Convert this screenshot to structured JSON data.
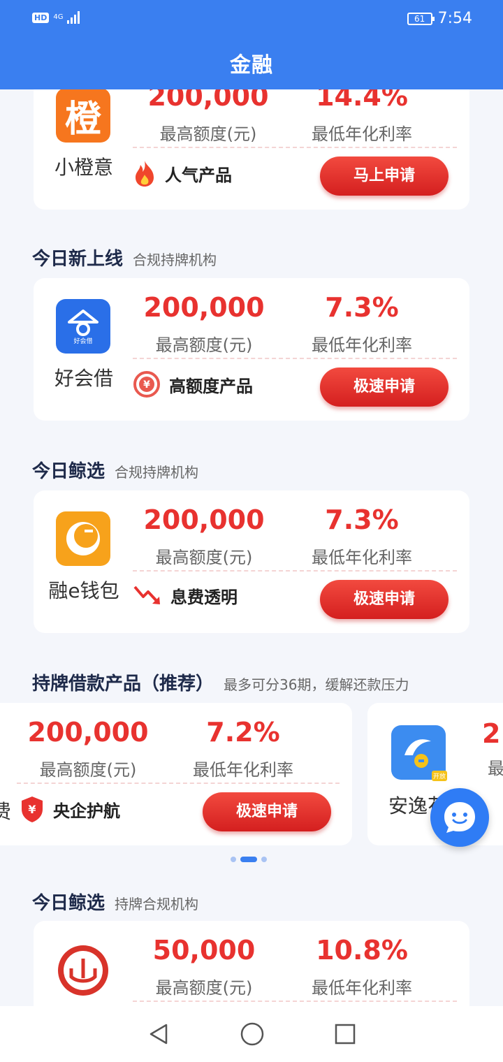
{
  "status": {
    "hd": "HD",
    "net": "4G",
    "battery": "61",
    "time": "7:54"
  },
  "header": {
    "title": "金融"
  },
  "sections": [
    {
      "title": "今日新上线",
      "subtitle": "合规持牌机构"
    },
    {
      "title": "今日鲸选",
      "subtitle": "合规持牌机构"
    },
    {
      "title": "持牌借款产品（推荐）",
      "subtitle": "最多可分36期，缓解还款压力"
    },
    {
      "title": "今日鲸选",
      "subtitle": "持牌合规机构"
    }
  ],
  "labels": {
    "amount_caption": "最高额度(元)",
    "rate_caption": "最低年化利率"
  },
  "cards": [
    {
      "name": "小橙意",
      "logo_text": "橙",
      "amount": "200,000",
      "rate": "14.4%",
      "feature": "人气产品",
      "feature_icon": "fire-icon",
      "button": "马上申请"
    },
    {
      "name": "好会借",
      "logo_text": "好会借",
      "amount": "200,000",
      "rate": "7.3%",
      "feature": "高额度产品",
      "feature_icon": "yen-coin-icon",
      "button": "极速申请"
    },
    {
      "name": "融e钱包",
      "amount": "200,000",
      "rate": "7.3%",
      "feature": "息费透明",
      "feature_icon": "trend-down-icon",
      "button": "极速申请"
    },
    {
      "name": "",
      "amount": "50,000",
      "rate": "10.8%"
    }
  ],
  "carousel": {
    "card": {
      "amount": "200,000",
      "rate": "7.2%",
      "feature": "央企护航",
      "feature_icon": "shield-yen-icon",
      "button": "极速申请",
      "left_clip_text": "费"
    },
    "next_card": {
      "name": "安逸花",
      "amount_clip": "2",
      "caption_clip": "最",
      "badge": "开放"
    },
    "dots": 3,
    "active_dot": 1
  },
  "colors": {
    "primary": "#3a7ff0",
    "accent_red": "#e8322f",
    "bg": "#f4f6fb"
  }
}
